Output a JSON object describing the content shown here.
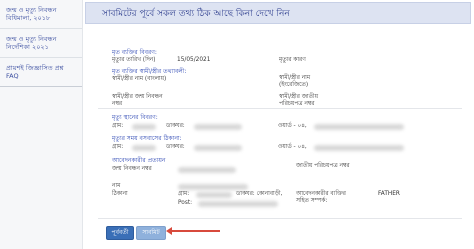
{
  "sidebar": {
    "items": [
      {
        "label": "জন্ম ও মৃত্যু নিবন্ধন বিধিমালা, ২০১৮"
      },
      {
        "label": "জন্ম ও মৃত্যু নিবন্ধন নির্দেশিকা ২০২১"
      },
      {
        "label": "প্রায়শই জিজ্ঞাসিত প্রশ্ন FAQ"
      }
    ]
  },
  "header": {
    "title": "সাবমিটের পূর্বে সকল তথ্য ঠিক আছে কিনা দেখে নিন"
  },
  "deceased_info": {
    "section_title": "মৃত ব্যক্তির বিবরণ:",
    "death_date_label": "মৃত্যুর তারিখ (দিন)",
    "death_date_value": "15/05/2021",
    "death_cause_label": "মৃত্যুর কারণ",
    "spouse_section_title": "মৃত ব্যক্তির স্বামী/স্ত্রীর তথ্যাবলী:",
    "spouse_name_bn_label": "স্বামী/স্ত্রীর নাম (বাংলায়)",
    "spouse_name_en_label": "স্বামী/স্ত্রীর নাম (ইংরেজিতে)",
    "spouse_birth_reg_label": "স্বামী/স্ত্রীর জন্ম নিবন্ধন নম্বর",
    "spouse_nid_label": "স্বামী/স্ত্রীর জাতীয় পরিচয়পত্র নম্বর"
  },
  "death_place": {
    "section_title": "মৃত্যু স্থানের বিবরণ:",
    "village_label": "গ্রাম:",
    "post_label": "ডাকঘর:",
    "ward_label": "ওয়ার্ড - ০৪,"
  },
  "permanent_address": {
    "section_title": "মৃত্যুর সময় বসবাসের ঠিকানা:",
    "village_label": "গ্রাম:",
    "post_label": "ডাকঘর:",
    "ward_label": "ওয়ার্ড - ০৪,"
  },
  "applicant": {
    "section_title": "আবেদনকারীর প্রত্যয়ন",
    "birth_reg_label": "জন্ম নিবন্ধন নম্বর",
    "nid_label": "জাতীয় পরিচয়পত্র নম্বর",
    "name_label": "নাম",
    "address_label": "ঠিকানা",
    "address_village": "গ্রাম:",
    "address_post": "Post:",
    "address_post2": "ডাকঘর: কোনাবাড়ী,",
    "relation_label": "আবেদনকারীর ব্যক্তির সহিত সম্পর্ক:",
    "relation_value": "FATHER"
  },
  "buttons": {
    "previous": "পূর্ববর্তী",
    "submit": "সাবমিট"
  },
  "colors": {
    "banner_bg": "#dde3f2",
    "section_title": "#2f49b4",
    "prev_button": "#3a6fb7",
    "submit_button": "#8fb1dc",
    "arrow": "#d84a3c"
  }
}
